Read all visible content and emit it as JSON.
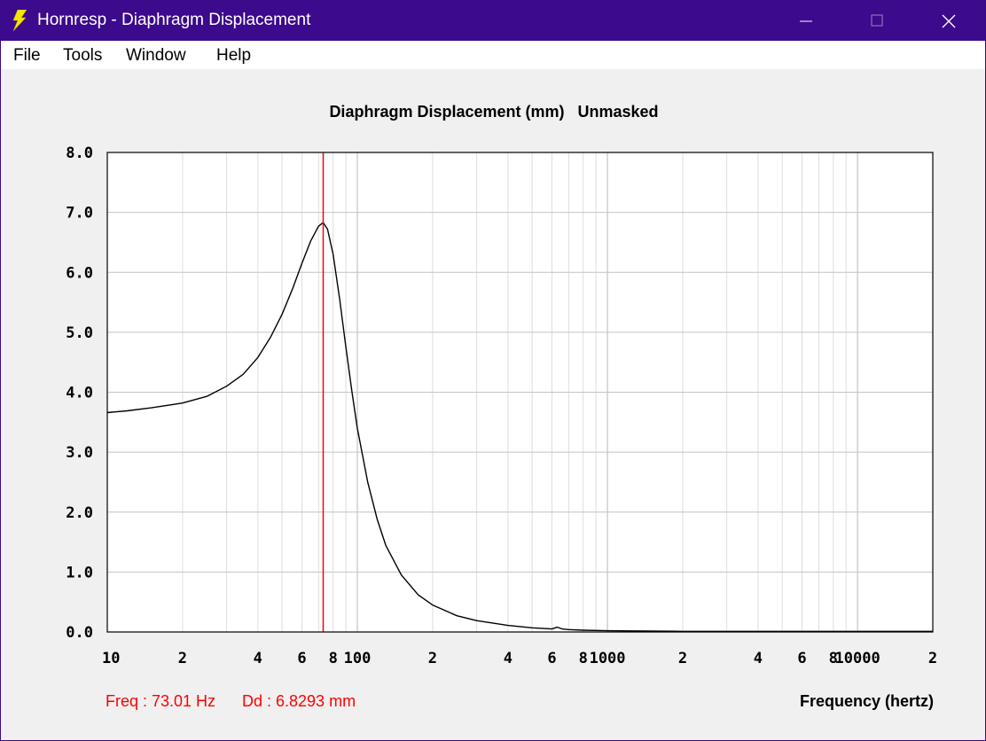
{
  "window": {
    "title": "Hornresp - Diaphragm Displacement",
    "title_bar_color": "#3c0a8c",
    "app_icon": "lightning-bolt-icon"
  },
  "menu": {
    "items": [
      {
        "label": "File"
      },
      {
        "label": "Tools"
      },
      {
        "label": "Window"
      },
      {
        "label": "Help"
      }
    ]
  },
  "readout": {
    "freq": "Freq : 73.01 Hz",
    "dd": "Dd : 6.8293 mm",
    "color": "#ff0000"
  },
  "chart_data": {
    "type": "line",
    "title": "Diaphragm Displacement (mm)",
    "subtitle": "Unmasked",
    "xlabel": "Frequency (hertz)",
    "ylabel": "",
    "x_scale": "log",
    "xlim": [
      10,
      20000
    ],
    "ylim": [
      0,
      8
    ],
    "grid": true,
    "y_ticks": [
      "0.0",
      "1.0",
      "2.0",
      "3.0",
      "4.0",
      "5.0",
      "6.0",
      "7.0",
      "8.0"
    ],
    "x_tick_labels": [
      {
        "x": 10,
        "label": "10"
      },
      {
        "x": 20,
        "label": "2"
      },
      {
        "x": 40,
        "label": "4"
      },
      {
        "x": 60,
        "label": "6"
      },
      {
        "x": 80,
        "label": "8"
      },
      {
        "x": 100,
        "label": "100"
      },
      {
        "x": 200,
        "label": "2"
      },
      {
        "x": 400,
        "label": "4"
      },
      {
        "x": 600,
        "label": "6"
      },
      {
        "x": 800,
        "label": "8"
      },
      {
        "x": 1000,
        "label": "1000"
      },
      {
        "x": 2000,
        "label": "2"
      },
      {
        "x": 4000,
        "label": "4"
      },
      {
        "x": 6000,
        "label": "6"
      },
      {
        "x": 8000,
        "label": "8"
      },
      {
        "x": 10000,
        "label": "10000"
      },
      {
        "x": 20000,
        "label": "2"
      }
    ],
    "marker": {
      "x": 73.01,
      "color": "#ff0000"
    },
    "series": [
      {
        "color": "#000000",
        "x": [
          10,
          12,
          15,
          18,
          20,
          25,
          30,
          35,
          40,
          45,
          50,
          55,
          60,
          65,
          70,
          73,
          76,
          80,
          85,
          90,
          95,
          100,
          110,
          120,
          130,
          150,
          175,
          200,
          250,
          300,
          400,
          500,
          600,
          630,
          660,
          700,
          800,
          1000,
          2000,
          5000,
          10000,
          20000
        ],
        "y": [
          3.66,
          3.69,
          3.74,
          3.79,
          3.82,
          3.93,
          4.1,
          4.3,
          4.58,
          4.92,
          5.3,
          5.72,
          6.15,
          6.52,
          6.77,
          6.83,
          6.72,
          6.3,
          5.55,
          4.75,
          4.02,
          3.4,
          2.5,
          1.88,
          1.44,
          0.95,
          0.62,
          0.45,
          0.27,
          0.19,
          0.11,
          0.07,
          0.05,
          0.08,
          0.05,
          0.04,
          0.03,
          0.02,
          0.01,
          0.01,
          0.01,
          0.01
        ]
      }
    ]
  }
}
